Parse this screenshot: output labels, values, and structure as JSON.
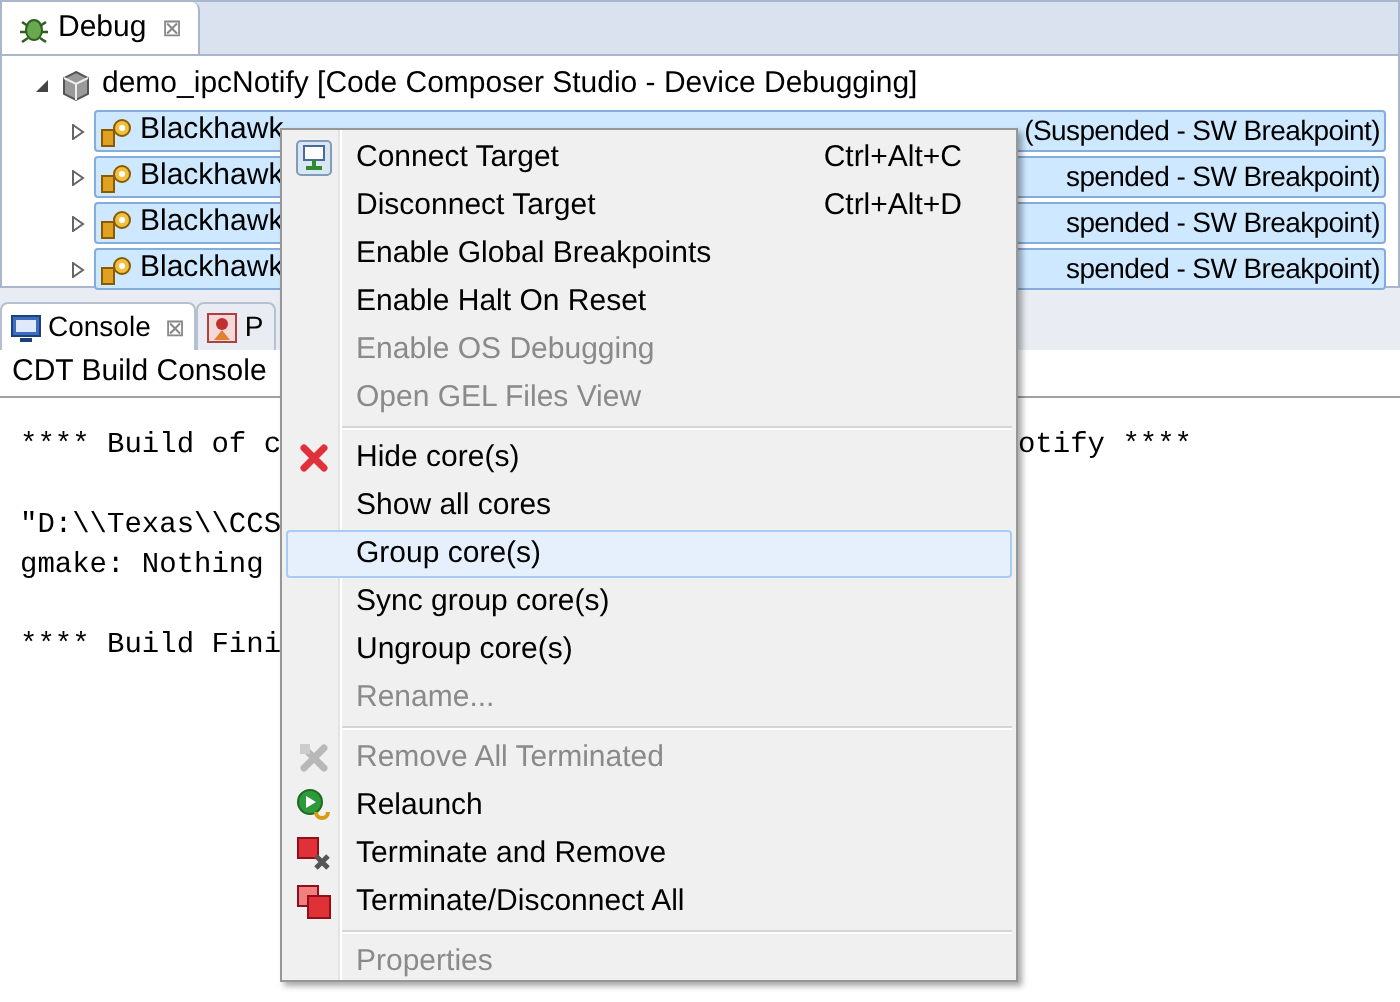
{
  "debug_view": {
    "tab": {
      "label": "Debug",
      "selected": true,
      "close": "⊠"
    },
    "tree": [
      {
        "label": "demo_ipcNotify [Code Composer Studio - Device Debugging]",
        "expanded": true,
        "children": [
          {
            "label": "Blackhawk",
            "label_end": "(Suspended - SW Breakpoint)",
            "selected": true
          },
          {
            "label": "Blackhawk",
            "label_end": "spended - SW Breakpoint)",
            "selected": true
          },
          {
            "label": "Blackhawk",
            "label_end": "spended - SW Breakpoint)",
            "selected": true
          },
          {
            "label": "Blackhawk",
            "label_end": "spended - SW Breakpoint)",
            "selected": true
          }
        ]
      }
    ]
  },
  "console_view": {
    "tabs": [
      {
        "label": "Console",
        "close": "⊠",
        "selected": true
      },
      {
        "label": "P",
        "selected": false
      }
    ],
    "console_name": "CDT Build Console",
    "lines": [
      {
        "kind": "text",
        "text": "**** Build of c",
        "end": "otify ****"
      },
      {
        "kind": "blank"
      },
      {
        "kind": "text",
        "text": "\"D:\\\\Texas\\\\CCS"
      },
      {
        "kind": "text",
        "text": "gmake: Nothing"
      },
      {
        "kind": "blank"
      },
      {
        "kind": "text",
        "text": "**** Build Fini"
      }
    ]
  },
  "context_menu": [
    {
      "kind": "item",
      "label": "Connect Target",
      "shortcut": "Ctrl+Alt+C",
      "disabled": false,
      "selected": false
    },
    {
      "kind": "item",
      "label": "Disconnect Target",
      "shortcut": "Ctrl+Alt+D",
      "disabled": false,
      "selected": false
    },
    {
      "kind": "item",
      "label": "Enable Global Breakpoints",
      "disabled": false,
      "selected": false
    },
    {
      "kind": "item",
      "label": "Enable Halt On Reset",
      "disabled": false,
      "selected": false
    },
    {
      "kind": "item",
      "label": "Enable OS Debugging",
      "disabled": true,
      "selected": false
    },
    {
      "kind": "item",
      "label": "Open GEL Files View",
      "disabled": true,
      "selected": false
    },
    {
      "kind": "separator"
    },
    {
      "kind": "item",
      "label": "Hide core(s)",
      "disabled": false,
      "selected": false
    },
    {
      "kind": "item",
      "label": "Show all cores",
      "disabled": false,
      "selected": false
    },
    {
      "kind": "item",
      "label": "Group core(s)",
      "disabled": false,
      "selected": true
    },
    {
      "kind": "item",
      "label": "Sync group core(s)",
      "disabled": false,
      "selected": false
    },
    {
      "kind": "item",
      "label": "Ungroup core(s)",
      "disabled": false,
      "selected": false
    },
    {
      "kind": "item",
      "label": "Rename...",
      "disabled": true,
      "selected": false
    },
    {
      "kind": "separator"
    },
    {
      "kind": "item",
      "label": "Remove All Terminated",
      "disabled": true,
      "selected": false
    },
    {
      "kind": "item",
      "label": "Relaunch",
      "disabled": false,
      "selected": false
    },
    {
      "kind": "item",
      "label": "Terminate and Remove",
      "disabled": false,
      "selected": false
    },
    {
      "kind": "item",
      "label": "Terminate/Disconnect All",
      "disabled": false,
      "selected": false
    },
    {
      "kind": "separator"
    },
    {
      "kind": "item",
      "label": "Properties",
      "disabled": true,
      "selected": false
    }
  ]
}
